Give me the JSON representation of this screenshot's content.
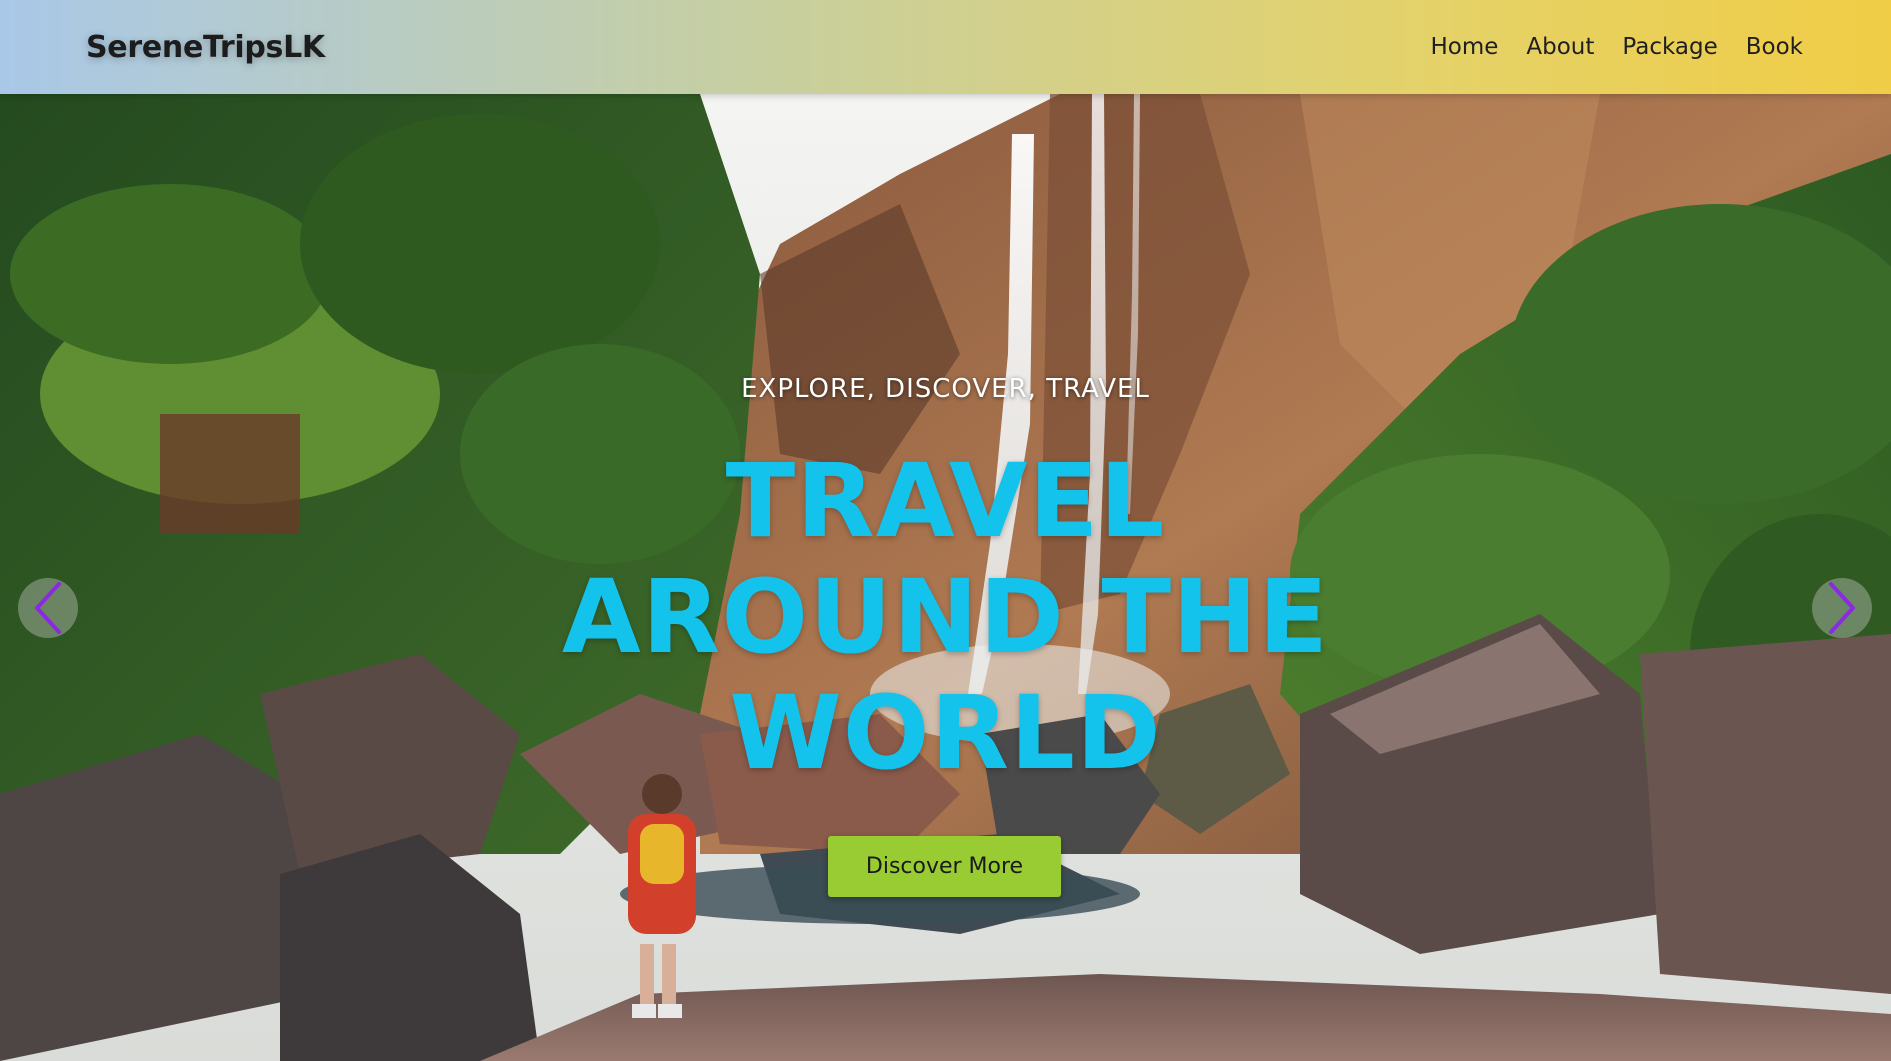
{
  "navbar": {
    "brand": "SereneTripsLK",
    "links": [
      {
        "label": "Home"
      },
      {
        "label": "About"
      },
      {
        "label": "Package"
      },
      {
        "label": "Book"
      }
    ]
  },
  "hero": {
    "background_icon": "waterfall-landscape-photo",
    "eyebrow": "EXPLORE, DISCOVER, TRAVEL",
    "headline_lines": [
      "TRAVEL",
      "AROUND THE",
      "WORLD"
    ],
    "cta_label": "Discover More",
    "prev_icon": "chevron-left-icon",
    "next_icon": "chevron-right-icon"
  },
  "colors": {
    "headline": "#13c3ec",
    "cta_background": "#99cc33",
    "arrow": "#8a2be2",
    "navbar_gradient_start": "#a9c8e8",
    "navbar_gradient_end": "#f0cd45"
  }
}
